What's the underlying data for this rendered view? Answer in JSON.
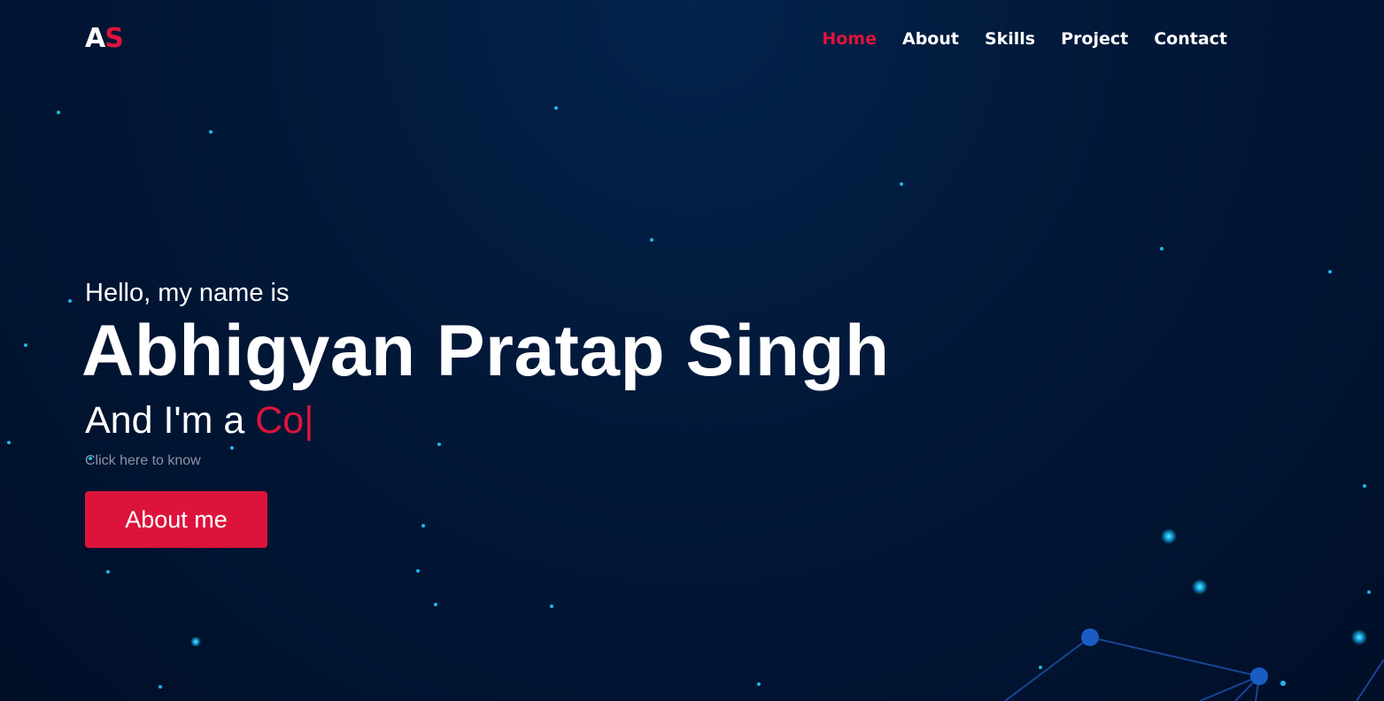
{
  "nav": {
    "logo_first": "A",
    "logo_second": "S",
    "items": [
      {
        "label": "Home",
        "active": true
      },
      {
        "label": "About",
        "active": false
      },
      {
        "label": "Skills",
        "active": false
      },
      {
        "label": "Project",
        "active": false
      },
      {
        "label": "Contact",
        "active": false
      }
    ]
  },
  "hero": {
    "greeting": "Hello, my name is",
    "name": "Abhigyan Pratap Singh",
    "role_prefix": "And I'm a",
    "role_typed": "Co",
    "cursor": "|",
    "hint": "Click here to know",
    "button_label": "About me"
  },
  "colors": {
    "accent": "#dc143c",
    "background": "#011431",
    "text": "#ffffff",
    "particles": "#1ec8ff"
  }
}
